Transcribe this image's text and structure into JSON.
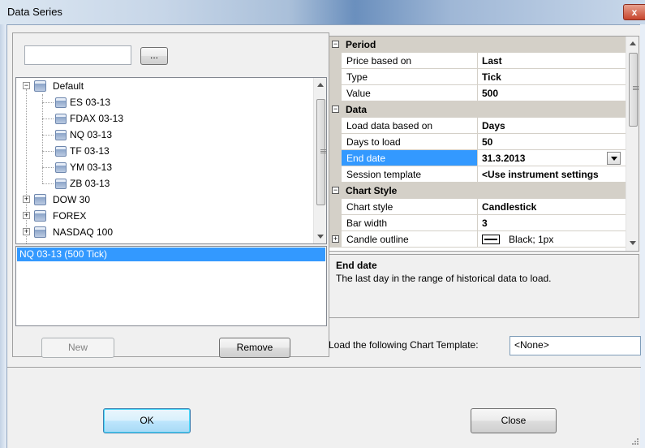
{
  "window": {
    "title": "Data Series",
    "close_glyph": "x"
  },
  "instruments": {
    "search_value": "",
    "browse_label": "...",
    "tree": [
      {
        "label": "Default",
        "expanded": true,
        "children": [
          "ES 03-13",
          "FDAX 03-13",
          "NQ 03-13",
          "TF 03-13",
          "YM 03-13",
          "ZB 03-13"
        ]
      },
      {
        "label": "DOW 30",
        "expanded": false
      },
      {
        "label": "FOREX",
        "expanded": false
      },
      {
        "label": "NASDAQ 100",
        "expanded": false
      }
    ]
  },
  "series": {
    "items": [
      "NQ 03-13 (500 Tick)"
    ],
    "new_label": "New",
    "remove_label": "Remove"
  },
  "properties": {
    "categories": {
      "period": "Period",
      "data": "Data",
      "chart_style": "Chart Style"
    },
    "rows": {
      "price_based_on": {
        "name": "Price based on",
        "value": "Last"
      },
      "type": {
        "name": "Type",
        "value": "Tick"
      },
      "value": {
        "name": "Value",
        "value": "500"
      },
      "load_data_based_on": {
        "name": "Load data based on",
        "value": "Days"
      },
      "days_to_load": {
        "name": "Days to load",
        "value": "50"
      },
      "end_date": {
        "name": "End date",
        "value": "31.3.2013"
      },
      "session_template": {
        "name": "Session template",
        "value": "<Use instrument settings"
      },
      "chart_style": {
        "name": "Chart style",
        "value": "Candlestick"
      },
      "bar_width": {
        "name": "Bar width",
        "value": "3"
      },
      "candle_outline": {
        "name": "Candle outline",
        "value": "Black; 1px"
      }
    },
    "collapse_glyph": "−",
    "expand_glyph": "+",
    "description": {
      "title": "End date",
      "text": "The last day in the range of historical data to load."
    }
  },
  "chart_template": {
    "label": "Load the following Chart Template:",
    "selected": "<None>"
  },
  "footer": {
    "ok_label": "OK",
    "close_label": "Close"
  },
  "colors": {
    "selection": "#3399ff",
    "category_bg": "#d4d0c8"
  }
}
